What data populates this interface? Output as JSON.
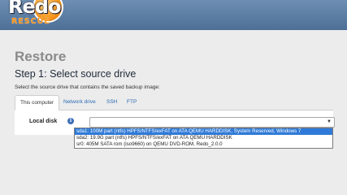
{
  "brand": {
    "name": "Redo",
    "sub": "RESCUE"
  },
  "page": {
    "title": "Restore",
    "step_title": "Step 1: Select source drive",
    "step_desc": "Select the source drive that contains the saved backup image:"
  },
  "tabs": [
    {
      "label": "This computer",
      "active": true
    },
    {
      "label": "Network drive",
      "active": false
    },
    {
      "label": "SSH",
      "active": false
    },
    {
      "label": "FTP",
      "active": false
    }
  ],
  "form": {
    "local_disk_label": "Local disk",
    "info_icon": "info-icon",
    "caret_icon": "chevron-down-icon",
    "options": [
      {
        "label": "sda1: 100M part (ntfs) HPFS/NTFS/exFAT on ATA QEMU HARDDISK, System Reserved, Windows 7",
        "selected": true
      },
      {
        "label": "sda2: 19.9G part (ntfs) HPFS/NTFS/exFAT on ATA QEMU HARDDISK",
        "selected": false
      },
      {
        "label": "sr0: 405M SATA rom (iso9660) on QEMU DVD-ROM, Redo_2.0.0",
        "selected": false
      }
    ]
  },
  "colors": {
    "header": "#4e6f96",
    "accent": "#f7961d",
    "link": "#2a6ab5",
    "selection": "#2f7ad8"
  }
}
